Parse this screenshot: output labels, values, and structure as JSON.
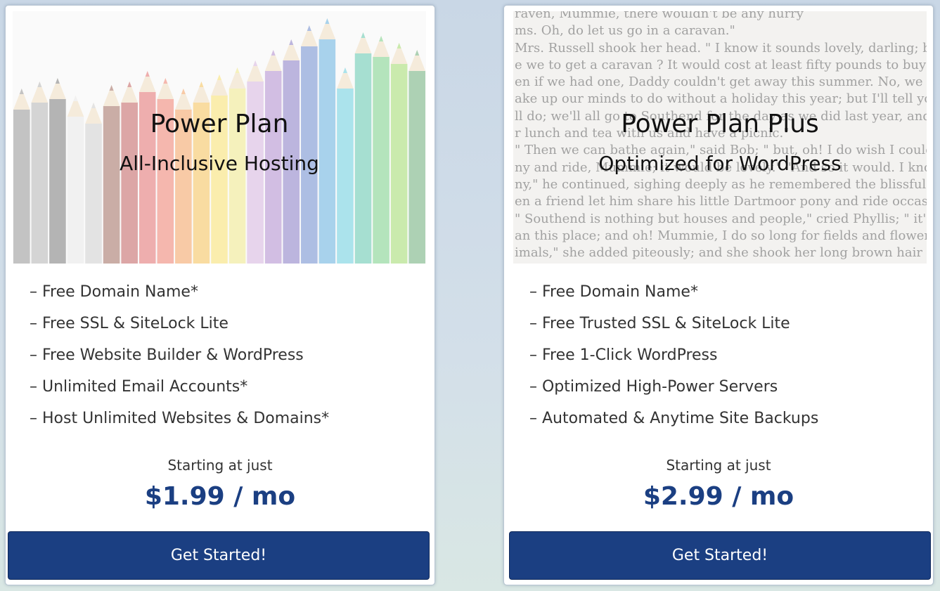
{
  "plans": [
    {
      "title": "Power Plan",
      "subtitle": "All-Inclusive Hosting",
      "hero_image": "colored-pencils",
      "features": [
        "– Free Domain Name*",
        "– Free SSL & SiteLock Lite",
        "– Free Website Builder & WordPress",
        "– Unlimited Email Accounts*",
        "– Host Unlimited Websites & Domains*"
      ],
      "starting_label": "Starting at just",
      "price": "$1.99 / mo",
      "cta_label": "Get Started!"
    },
    {
      "title": "Power Plan Plus",
      "subtitle": "Optimized for WordPress",
      "hero_image": "book-page-text",
      "hero_text_lines": [
        "raven, Mummie, there wouldn't be any hurry",
        "ms. Oh, do let us go in a caravan.\"",
        "Mrs. Russell shook her head. \" I know it sounds lovely, darling; but",
        "e we to get a caravan ? It would cost at least fifty pounds to buy one",
        "en if we had one, Daddy couldn't get away this summer. No, we",
        "ake up our minds to do without a holiday this year; but I'll tell you what",
        "ll do; we'll all go to Southend for the day as we did last year, and",
        "r lunch and tea with us and have a picnic.\"",
        "\" Then we can bathe again,\" said Bob; \" but, oh! I do wish I could",
        "ny and ride, Mummie; it would be lovely.\" \"And so it would. I know how I long",
        "ny,\" he continued, sighing deeply as he remembered the blissful hours",
        "en a friend let him share his little Dartmoor pony and ride occasionally.",
        "\" Southend is nothing but houses and people,\" cried Phyllis; \" it's not",
        "an this place; and oh! Mummie, I do so long for fields and flowers",
        "imals,\" she added piteously; and she shook her long brown hair from"
      ],
      "features": [
        "– Free Domain Name*",
        "– Free Trusted SSL & SiteLock Lite",
        "– Free 1-Click WordPress",
        "– Optimized High-Power Servers",
        "– Automated & Anytime Site Backups"
      ],
      "starting_label": "Starting at just",
      "price": "$2.99 / mo",
      "cta_label": "Get Started!"
    }
  ],
  "colors": {
    "brand_blue": "#1b3f82",
    "text_dark": "#333333",
    "card_bg": "#ffffff"
  }
}
